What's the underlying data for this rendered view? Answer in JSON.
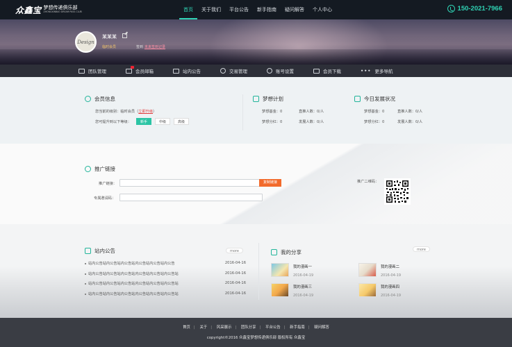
{
  "header": {
    "logo_mark": "众鑫宝",
    "logo_cn": "梦想传递俱乐部",
    "logo_en": "ZHONGXINBAO DREAM PASS CLUB",
    "nav": [
      "首页",
      "关于我们",
      "平台公告",
      "新手指南",
      "疑问解答",
      "个人中心"
    ],
    "phone": "150-2021-7966"
  },
  "profile": {
    "avatar_text": "Design",
    "name": "某某某",
    "tag": "临时会员",
    "sign_label": "签到",
    "sign_link": "未来签到记录"
  },
  "subnav": [
    "团队管理",
    "会员邮箱",
    "站内公告",
    "交易管理",
    "账号设置",
    "会员下载",
    "更多导航"
  ],
  "member": {
    "title": "会员信息",
    "line1_prefix": "您当前的级别：临时会员（",
    "line1_link": "立即升级",
    "line1_suffix": "）",
    "line2": "您可提升到以下等级：",
    "levels": [
      "新手",
      "中级",
      "高级"
    ]
  },
  "dream": {
    "title": "梦想计划",
    "rows": [
      [
        "梦想基金：0",
        "直推人数：0/人"
      ],
      [
        "梦想分红：0",
        "发展人数：0/人"
      ]
    ]
  },
  "today": {
    "title": "今日发展状况",
    "rows": [
      [
        "梦想基金：0",
        "直推人数：0/人"
      ],
      [
        "梦想分红：0",
        "发展人数：0/人"
      ]
    ]
  },
  "promo": {
    "title": "推广链接",
    "link_label": "推广链接：",
    "copy_btn": "复制链接",
    "code_label": "专属邀请码：",
    "qr_label": "推广二维码："
  },
  "notice": {
    "title": "站内公告",
    "more": "more",
    "items": [
      {
        "text": "站内公告站内公告站内公告站内公告站内公告站内公告",
        "date": "2016-04-16"
      },
      {
        "text": "站内公告站内公告站内公告站内公告站内公告站内公告站",
        "date": "2016-04-16"
      },
      {
        "text": "站内公告站内公告站内公告站内公告站内公告站内公告站",
        "date": "2016-04-16"
      },
      {
        "text": "站内公告站内公告站内公告站内公告站内公告站内公告站",
        "date": "2016-04-16"
      }
    ]
  },
  "share": {
    "title": "我的分享",
    "more": "more",
    "items": [
      {
        "title": "我的漫画一",
        "date": "2016-04-19"
      },
      {
        "title": "我的漫画二",
        "date": "2016-04-19"
      },
      {
        "title": "我的漫画三",
        "date": "2016-04-19"
      },
      {
        "title": "我的漫画四",
        "date": "2016-04-19"
      }
    ]
  },
  "footer": {
    "links": [
      "首页",
      "关于",
      "风采展示",
      "团队分享",
      "平台公告",
      "新手指南",
      "疑问解答"
    ],
    "copyright": "copyright©2016 众鑫宝梦想传递俱乐部 版权所有 众鑫宝"
  },
  "colors": {
    "accent": "#2bc4a4",
    "orange": "#f26a2b",
    "dark": "#141a22"
  }
}
